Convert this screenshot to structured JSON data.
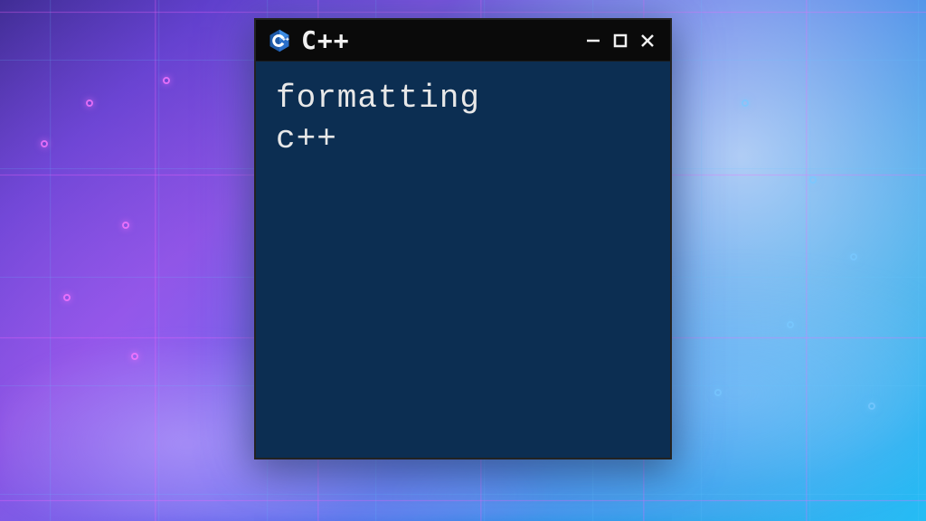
{
  "window": {
    "title": "C++",
    "icon_name": "cpp-logo-icon"
  },
  "content": {
    "line1": "formatting",
    "line2": "c++"
  },
  "colors": {
    "content_bg": "#0c2e52",
    "titlebar_bg": "#0a0a0a",
    "text": "#e8e8e8"
  }
}
